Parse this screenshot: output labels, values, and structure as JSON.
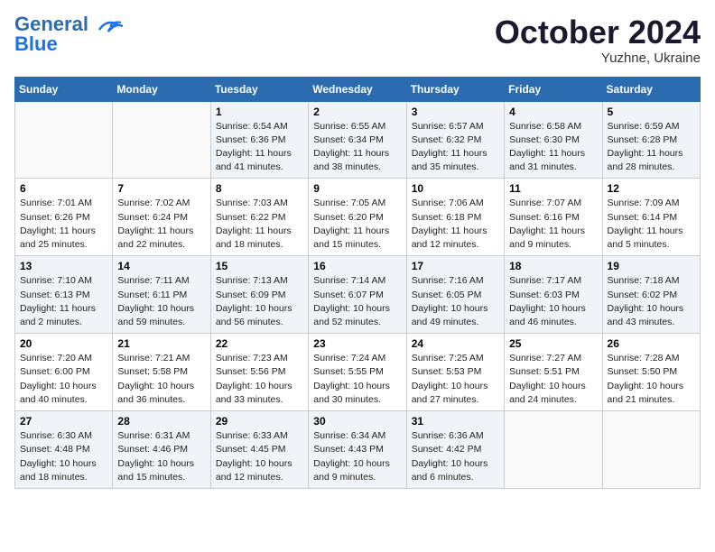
{
  "header": {
    "logo_line1": "General",
    "logo_line2": "Blue",
    "month": "October 2024",
    "location": "Yuzhne, Ukraine"
  },
  "weekdays": [
    "Sunday",
    "Monday",
    "Tuesday",
    "Wednesday",
    "Thursday",
    "Friday",
    "Saturday"
  ],
  "weeks": [
    [
      {
        "day": "",
        "info": ""
      },
      {
        "day": "",
        "info": ""
      },
      {
        "day": "1",
        "info": "Sunrise: 6:54 AM\nSunset: 6:36 PM\nDaylight: 11 hours and 41 minutes."
      },
      {
        "day": "2",
        "info": "Sunrise: 6:55 AM\nSunset: 6:34 PM\nDaylight: 11 hours and 38 minutes."
      },
      {
        "day": "3",
        "info": "Sunrise: 6:57 AM\nSunset: 6:32 PM\nDaylight: 11 hours and 35 minutes."
      },
      {
        "day": "4",
        "info": "Sunrise: 6:58 AM\nSunset: 6:30 PM\nDaylight: 11 hours and 31 minutes."
      },
      {
        "day": "5",
        "info": "Sunrise: 6:59 AM\nSunset: 6:28 PM\nDaylight: 11 hours and 28 minutes."
      }
    ],
    [
      {
        "day": "6",
        "info": "Sunrise: 7:01 AM\nSunset: 6:26 PM\nDaylight: 11 hours and 25 minutes."
      },
      {
        "day": "7",
        "info": "Sunrise: 7:02 AM\nSunset: 6:24 PM\nDaylight: 11 hours and 22 minutes."
      },
      {
        "day": "8",
        "info": "Sunrise: 7:03 AM\nSunset: 6:22 PM\nDaylight: 11 hours and 18 minutes."
      },
      {
        "day": "9",
        "info": "Sunrise: 7:05 AM\nSunset: 6:20 PM\nDaylight: 11 hours and 15 minutes."
      },
      {
        "day": "10",
        "info": "Sunrise: 7:06 AM\nSunset: 6:18 PM\nDaylight: 11 hours and 12 minutes."
      },
      {
        "day": "11",
        "info": "Sunrise: 7:07 AM\nSunset: 6:16 PM\nDaylight: 11 hours and 9 minutes."
      },
      {
        "day": "12",
        "info": "Sunrise: 7:09 AM\nSunset: 6:14 PM\nDaylight: 11 hours and 5 minutes."
      }
    ],
    [
      {
        "day": "13",
        "info": "Sunrise: 7:10 AM\nSunset: 6:13 PM\nDaylight: 11 hours and 2 minutes."
      },
      {
        "day": "14",
        "info": "Sunrise: 7:11 AM\nSunset: 6:11 PM\nDaylight: 10 hours and 59 minutes."
      },
      {
        "day": "15",
        "info": "Sunrise: 7:13 AM\nSunset: 6:09 PM\nDaylight: 10 hours and 56 minutes."
      },
      {
        "day": "16",
        "info": "Sunrise: 7:14 AM\nSunset: 6:07 PM\nDaylight: 10 hours and 52 minutes."
      },
      {
        "day": "17",
        "info": "Sunrise: 7:16 AM\nSunset: 6:05 PM\nDaylight: 10 hours and 49 minutes."
      },
      {
        "day": "18",
        "info": "Sunrise: 7:17 AM\nSunset: 6:03 PM\nDaylight: 10 hours and 46 minutes."
      },
      {
        "day": "19",
        "info": "Sunrise: 7:18 AM\nSunset: 6:02 PM\nDaylight: 10 hours and 43 minutes."
      }
    ],
    [
      {
        "day": "20",
        "info": "Sunrise: 7:20 AM\nSunset: 6:00 PM\nDaylight: 10 hours and 40 minutes."
      },
      {
        "day": "21",
        "info": "Sunrise: 7:21 AM\nSunset: 5:58 PM\nDaylight: 10 hours and 36 minutes."
      },
      {
        "day": "22",
        "info": "Sunrise: 7:23 AM\nSunset: 5:56 PM\nDaylight: 10 hours and 33 minutes."
      },
      {
        "day": "23",
        "info": "Sunrise: 7:24 AM\nSunset: 5:55 PM\nDaylight: 10 hours and 30 minutes."
      },
      {
        "day": "24",
        "info": "Sunrise: 7:25 AM\nSunset: 5:53 PM\nDaylight: 10 hours and 27 minutes."
      },
      {
        "day": "25",
        "info": "Sunrise: 7:27 AM\nSunset: 5:51 PM\nDaylight: 10 hours and 24 minutes."
      },
      {
        "day": "26",
        "info": "Sunrise: 7:28 AM\nSunset: 5:50 PM\nDaylight: 10 hours and 21 minutes."
      }
    ],
    [
      {
        "day": "27",
        "info": "Sunrise: 6:30 AM\nSunset: 4:48 PM\nDaylight: 10 hours and 18 minutes."
      },
      {
        "day": "28",
        "info": "Sunrise: 6:31 AM\nSunset: 4:46 PM\nDaylight: 10 hours and 15 minutes."
      },
      {
        "day": "29",
        "info": "Sunrise: 6:33 AM\nSunset: 4:45 PM\nDaylight: 10 hours and 12 minutes."
      },
      {
        "day": "30",
        "info": "Sunrise: 6:34 AM\nSunset: 4:43 PM\nDaylight: 10 hours and 9 minutes."
      },
      {
        "day": "31",
        "info": "Sunrise: 6:36 AM\nSunset: 4:42 PM\nDaylight: 10 hours and 6 minutes."
      },
      {
        "day": "",
        "info": ""
      },
      {
        "day": "",
        "info": ""
      }
    ]
  ]
}
